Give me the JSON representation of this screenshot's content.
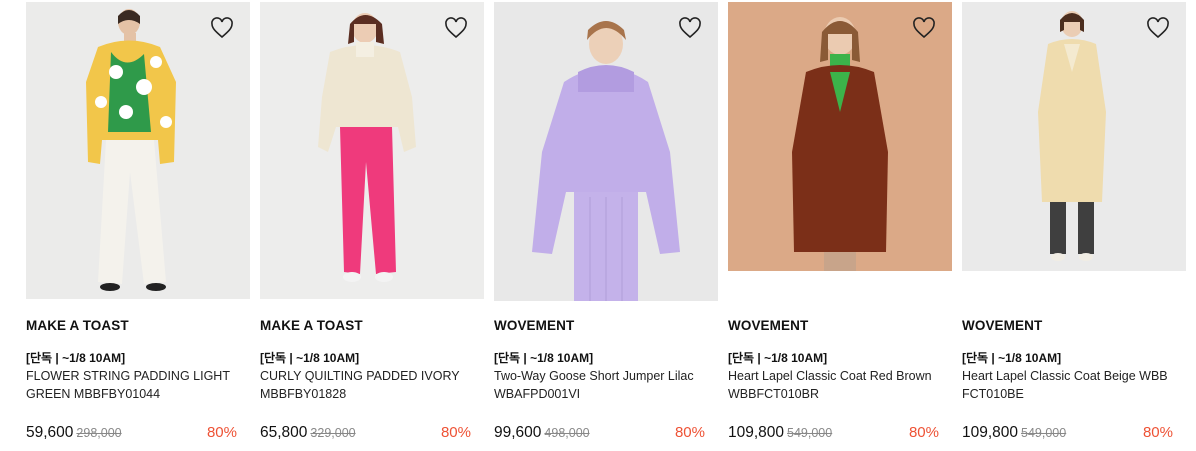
{
  "products": [
    {
      "brand": "MAKE A TOAST",
      "tag": "[단독 | ~1/8 10AM]",
      "name": "FLOWER STRING PADDING LIGHT GREEN MBBFBY01044",
      "price": "59,600",
      "original_price": "298,000",
      "discount": "80%",
      "wishlist_icon": "heart-outline"
    },
    {
      "brand": "MAKE A TOAST",
      "tag": "[단독 | ~1/8 10AM]",
      "name": "CURLY QUILTING PADDED IVORY MBBFBY01828",
      "price": "65,800",
      "original_price": "329,000",
      "discount": "80%",
      "wishlist_icon": "heart-outline"
    },
    {
      "brand": "WOVEMENT",
      "tag": "[단독 | ~1/8 10AM]",
      "name": "Two-Way Goose Short Jumper Lilac WBAFPD001VI",
      "price": "99,600",
      "original_price": "498,000",
      "discount": "80%",
      "wishlist_icon": "heart-outline"
    },
    {
      "brand": "WOVEMENT",
      "tag": "[단독 | ~1/8 10AM]",
      "name": "Heart Lapel Classic Coat Red Brown WBBFCT010BR",
      "price": "109,800",
      "original_price": "549,000",
      "discount": "80%",
      "wishlist_icon": "heart-outline"
    },
    {
      "brand": "WOVEMENT",
      "tag": "[단독 | ~1/8 10AM]",
      "name": "Heart Lapel Classic Coat Beige WBB FCT010BE",
      "price": "109,800",
      "original_price": "549,000",
      "discount": "80%",
      "wishlist_icon": "heart-outline"
    }
  ],
  "colors": {
    "discount": "#ee5235",
    "background": "#ffffff"
  }
}
